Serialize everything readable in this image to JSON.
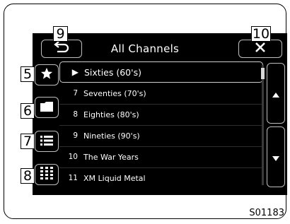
{
  "header": {
    "title": "All Channels",
    "back_icon": "back-arrow-icon",
    "close_icon": "close-icon"
  },
  "sidebar": {
    "items": [
      {
        "name": "favorites",
        "icon": "star-icon"
      },
      {
        "name": "folder",
        "icon": "folder-icon"
      },
      {
        "name": "list",
        "icon": "list-icon"
      },
      {
        "name": "keypad",
        "icon": "keypad-icon"
      }
    ]
  },
  "channels": [
    {
      "number": "▶",
      "name": "Sixties (60's)",
      "selected": true
    },
    {
      "number": "7",
      "name": "Seventies (70's)"
    },
    {
      "number": "8",
      "name": "Eighties (80's)"
    },
    {
      "number": "9",
      "name": "Nineties (90's)"
    },
    {
      "number": "10",
      "name": "The War Years"
    },
    {
      "number": "11",
      "name": "XM Liquid Metal"
    }
  ],
  "scroll": {
    "up_icon": "triangle-up-icon",
    "down_icon": "triangle-down-icon"
  },
  "callouts": [
    "9",
    "10",
    "5",
    "6",
    "7",
    "8"
  ],
  "figure_code": "S01183",
  "colors": {
    "screen": "#000000",
    "outline": "#bfbfbf",
    "text": "#ffffff"
  }
}
